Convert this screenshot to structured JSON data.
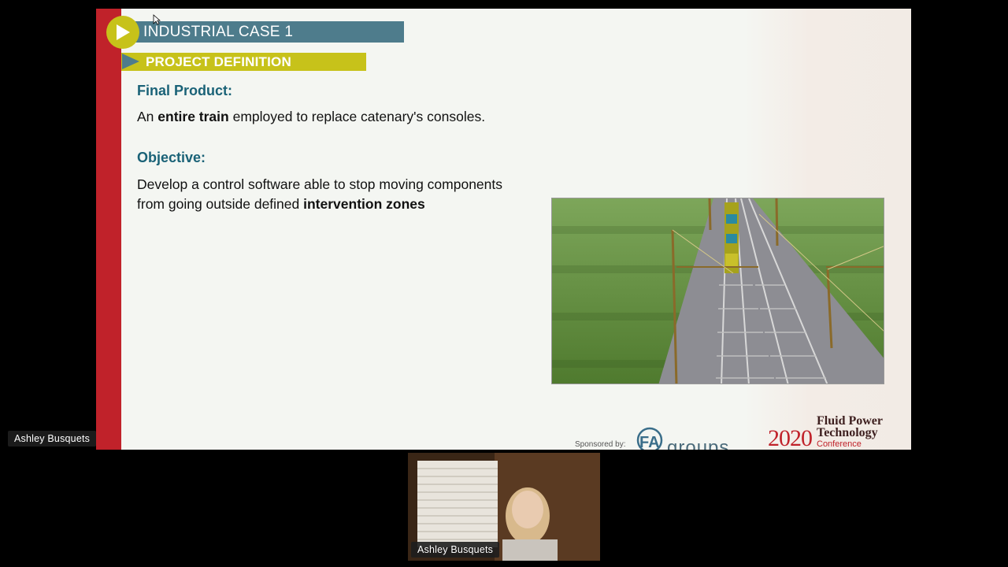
{
  "slide": {
    "title": "INDUSTRIAL CASE 1",
    "section": "PROJECT DEFINITION",
    "final_product": {
      "heading": "Final Product:",
      "line_pre": "An ",
      "line_bold": "entire train",
      "line_post": " employed to replace catenary's consoles."
    },
    "objective": {
      "heading": "Objective:",
      "line1": "Develop a control software able to stop moving components",
      "line2_pre": "from going outside defined ",
      "line2_bold": "intervention zones"
    },
    "sponsor_label": "Sponsored by:",
    "sponsor_logo_text": "groups",
    "conference": {
      "year": "2020",
      "name_line1": "Fluid Power",
      "name_line2": "Technology",
      "name_line3": "Conference"
    }
  },
  "participants": {
    "presenter_tag": "Ashley Busquets",
    "video_tile_tag": "Ashley Busquets"
  },
  "colors": {
    "accent_red": "#c0222a",
    "accent_teal": "#4e7c8c",
    "accent_olive": "#c7c21a",
    "heading_teal": "#1a6277"
  },
  "icons": [
    "play-icon",
    "section-arrow-icon",
    "mouse-cursor-icon"
  ]
}
